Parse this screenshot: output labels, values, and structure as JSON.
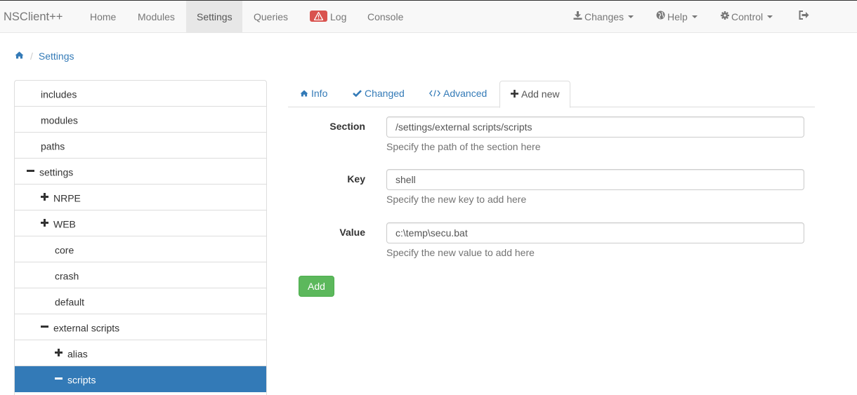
{
  "navbar": {
    "brand": "NSClient++",
    "items": [
      {
        "label": "Home"
      },
      {
        "label": "Modules"
      },
      {
        "label": "Settings",
        "active": true
      },
      {
        "label": "Queries"
      },
      {
        "label": "Log"
      },
      {
        "label": "Console"
      }
    ],
    "right_items": [
      {
        "label": "Changes",
        "icon": "download-icon"
      },
      {
        "label": "Help",
        "icon": "globe-icon"
      },
      {
        "label": "Control",
        "icon": "gear-icon"
      }
    ],
    "logout_icon": "logout-icon"
  },
  "breadcrumb": {
    "home_icon": "home-icon",
    "current": "Settings"
  },
  "tree": {
    "items": [
      {
        "label": "includes",
        "level": 0,
        "glyph": ""
      },
      {
        "label": "modules",
        "level": 0,
        "glyph": ""
      },
      {
        "label": "paths",
        "level": 0,
        "glyph": ""
      },
      {
        "label": "settings",
        "level": 0,
        "glyph": "minus"
      },
      {
        "label": "NRPE",
        "level": 1,
        "glyph": "plus"
      },
      {
        "label": "WEB",
        "level": 1,
        "glyph": "plus"
      },
      {
        "label": "core",
        "level": 1,
        "glyph": ""
      },
      {
        "label": "crash",
        "level": 1,
        "glyph": ""
      },
      {
        "label": "default",
        "level": 1,
        "glyph": ""
      },
      {
        "label": "external scripts",
        "level": 1,
        "glyph": "minus"
      },
      {
        "label": "alias",
        "level": 2,
        "glyph": "plus"
      },
      {
        "label": "scripts",
        "level": 2,
        "glyph": "minus",
        "active": true
      }
    ]
  },
  "tabs": [
    {
      "label": "Info",
      "icon": "home-icon"
    },
    {
      "label": "Changed",
      "icon": "check-icon"
    },
    {
      "label": "Advanced",
      "icon": "code-icon"
    },
    {
      "label": "Add new",
      "icon": "plus-icon",
      "active": true
    }
  ],
  "form": {
    "section": {
      "label": "Section",
      "value": "/settings/external scripts/scripts",
      "help": "Specify the path of the section here"
    },
    "key": {
      "label": "Key",
      "value": "shell",
      "help": "Specify the new key to add here"
    },
    "value": {
      "label": "Value",
      "value": "c:\\temp\\secu.bat",
      "help": "Specify the new value to add here"
    },
    "submit_label": "Add"
  },
  "colors": {
    "link": "#337ab7",
    "active_item": "#337ab7",
    "success": "#5cb85c",
    "danger": "#d9534f",
    "navbar_bg": "#f8f8f8"
  }
}
